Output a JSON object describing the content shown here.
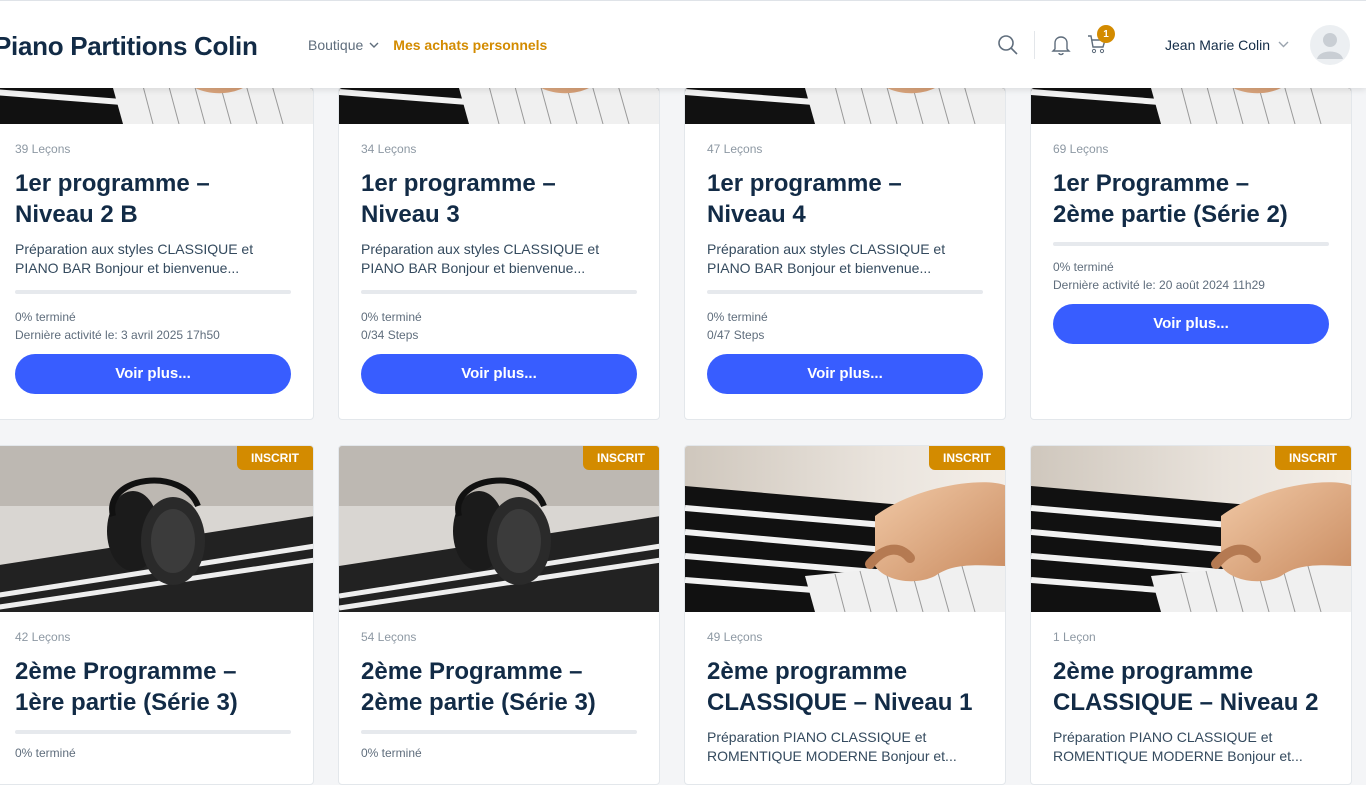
{
  "header": {
    "brand": "Piano Partitions Colin",
    "nav": {
      "boutique": "Boutique",
      "achats": "Mes achats personnels"
    },
    "cart_count": "1",
    "user_name": "Jean Marie Colin"
  },
  "row1": [
    {
      "lessons": "39 Leçons",
      "title_l1": "1er programme –",
      "title_l2": "Niveau 2 B",
      "desc_l1": "Préparation aux styles CLASSIQUE et",
      "desc_l2": "PIANO BAR Bonjour et bienvenue...",
      "status_l1": "0% terminé",
      "status_l2": "Dernière activité le: 3 avril 2025 17h50",
      "progress": 0,
      "button": "Voir plus..."
    },
    {
      "lessons": "34 Leçons",
      "title_l1": "1er programme –",
      "title_l2": "Niveau 3",
      "desc_l1": "Préparation aux styles CLASSIQUE et",
      "desc_l2": "PIANO BAR Bonjour et bienvenue...",
      "status_l1": "0% terminé",
      "status_l2": "0/34 Steps",
      "progress": 0,
      "button": "Voir plus..."
    },
    {
      "lessons": "47 Leçons",
      "title_l1": "1er programme –",
      "title_l2": "Niveau 4",
      "desc_l1": "Préparation aux styles CLASSIQUE et",
      "desc_l2": "PIANO BAR Bonjour et bienvenue...",
      "status_l1": "0% terminé",
      "status_l2": "0/47 Steps",
      "progress": 0,
      "button": "Voir plus..."
    },
    {
      "lessons": "69 Leçons",
      "title_l1": "1er Programme –",
      "title_l2": "2ème partie (Série 2)",
      "status_l1": "0% terminé",
      "status_l2": "Dernière activité le: 20 août 2024 11h29",
      "progress": 0,
      "button": "Voir plus..."
    }
  ],
  "row2": [
    {
      "badge": "INSCRIT",
      "lessons": "42 Leçons",
      "title_l1": "2ème Programme –",
      "title_l2": "1ère partie (Série 3)",
      "status_l1": "0% terminé",
      "progress": 0,
      "image": "headphones-on-keyboard"
    },
    {
      "badge": "INSCRIT",
      "lessons": "54 Leçons",
      "title_l1": "2ème Programme –",
      "title_l2": "2ème partie (Série 3)",
      "status_l1": "0% terminé",
      "progress": 0,
      "image": "headphones-on-keyboard"
    },
    {
      "badge": "INSCRIT",
      "lessons": "49 Leçons",
      "title_l1": "2ème programme",
      "title_l2": "CLASSIQUE – Niveau 1",
      "desc_l1": "Préparation PIANO CLASSIQUE et",
      "desc_l2": "ROMENTIQUE MODERNE Bonjour et...",
      "image": "hands-on-piano"
    },
    {
      "badge": "INSCRIT",
      "lessons": "1 Leçon",
      "title_l1": "2ème programme",
      "title_l2": "CLASSIQUE – Niveau 2",
      "desc_l1": "Préparation PIANO CLASSIQUE et",
      "desc_l2": "ROMENTIQUE MODERNE Bonjour et...",
      "image": "hands-on-piano"
    }
  ]
}
